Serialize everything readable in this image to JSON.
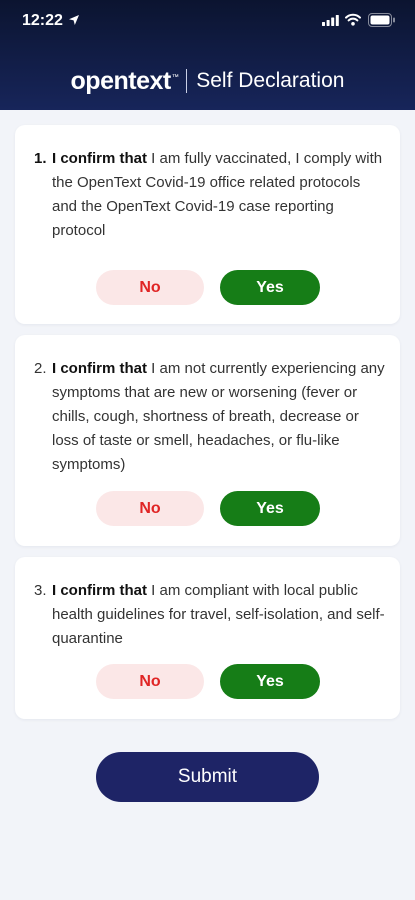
{
  "status_bar": {
    "time": "12:22",
    "icons": [
      "location-arrow-icon",
      "cellular-signal-icon",
      "wifi-icon",
      "battery-icon"
    ]
  },
  "header": {
    "logo_text": "opentext",
    "logo_tm": "™",
    "title": "Self Declaration"
  },
  "questions": [
    {
      "number": "1.",
      "lead": "I confirm that",
      "text": " I am fully vaccinated, I comply with the OpenText Covid-19 office related protocols and the OpenText Covid-19 case reporting protocol",
      "no_label": "No",
      "yes_label": "Yes"
    },
    {
      "number": "2.",
      "lead": "I confirm that",
      "text": " I am not currently experiencing any symptoms that are new or worsening (fever or chills, cough, shortness of breath, decrease or loss of taste or smell, headaches, or flu-like symptoms)",
      "no_label": "No",
      "yes_label": "Yes"
    },
    {
      "number": "3.",
      "lead": "I confirm that",
      "text": " I am compliant with local public health guidelines for travel, self-isolation, and self-quarantine",
      "no_label": "No",
      "yes_label": "Yes"
    }
  ],
  "submit_label": "Submit",
  "colors": {
    "header_top": "#0b1430",
    "header_bottom": "#17255a",
    "yes_button": "#167d17",
    "no_button_bg": "#fbe7e7",
    "no_button_text": "#e02525",
    "submit_button": "#1e2466",
    "page_background": "#f2f4f9"
  }
}
